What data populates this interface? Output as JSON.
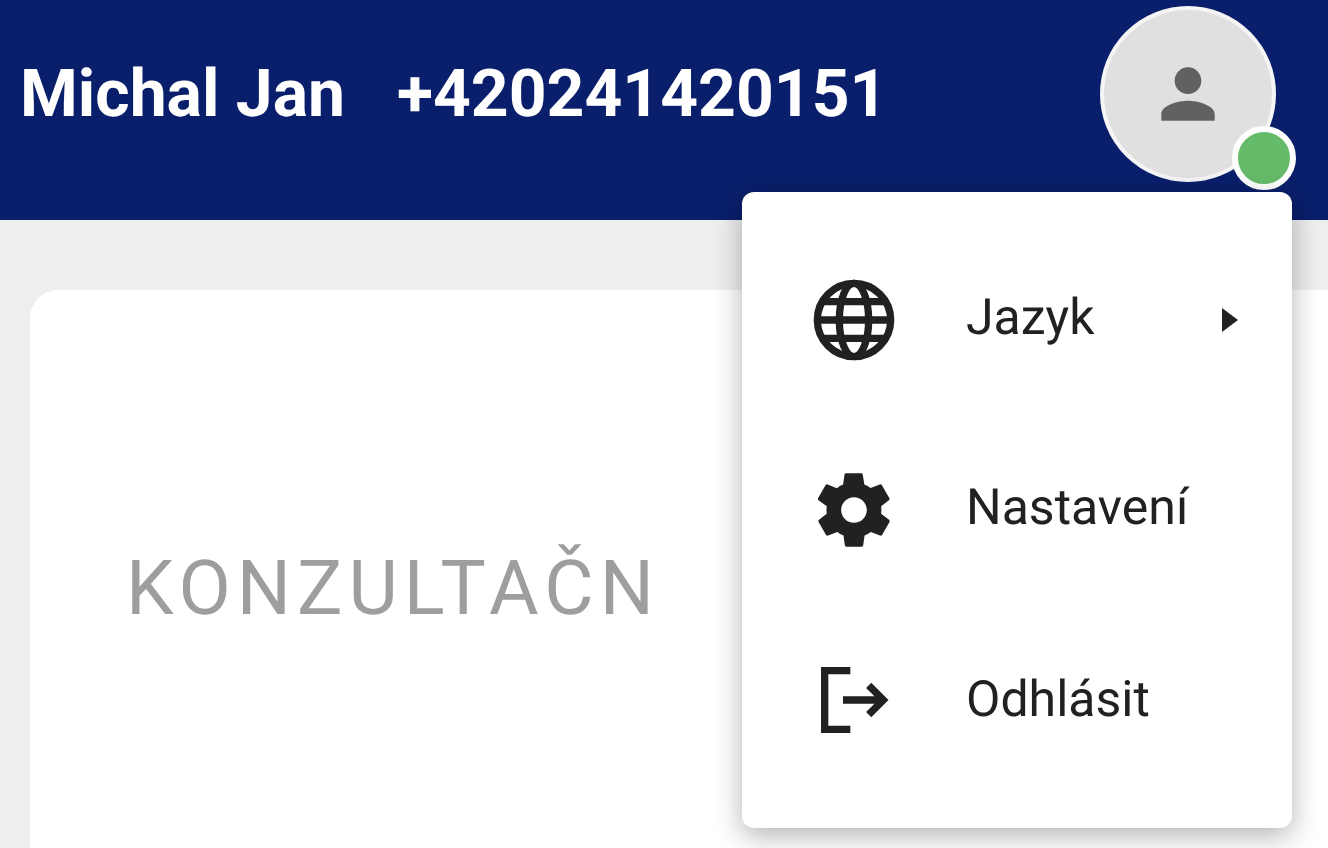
{
  "header": {
    "name": "Michal Jan",
    "phone": "+420241420151",
    "online": true
  },
  "card": {
    "title": "KONZULTAČN"
  },
  "menu": [
    {
      "label": "Jazyk",
      "kind": "language",
      "submenu": true
    },
    {
      "label": "Nastavení",
      "kind": "settings",
      "submenu": false
    },
    {
      "label": "Odhlásit",
      "kind": "logout",
      "submenu": false
    }
  ]
}
